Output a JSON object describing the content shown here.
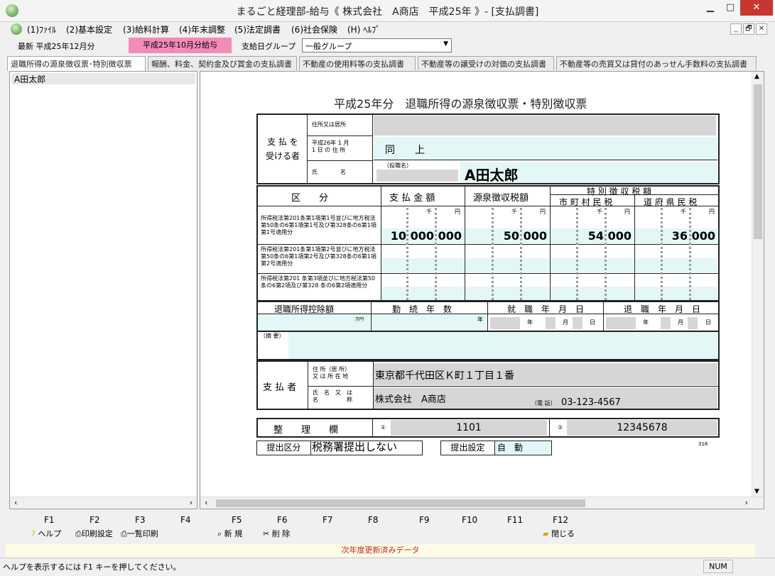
{
  "window": {
    "title": "まるごと経理部-給与《 株式会社　A商店　平成25年 》- [支払調書]",
    "minimize": "▁",
    "maximize": "□",
    "close": "✕"
  },
  "menu": {
    "items": [
      "(1)ﾌｧｲﾙ",
      "(2)基本設定",
      "(3)給料計算",
      "(4)年末調整",
      "(5)法定調書",
      "(6)社会保険",
      "(H) ﾍﾙﾌﾟ"
    ],
    "mdi_min": "_",
    "mdi_restore": "🗗",
    "mdi_close": "✕"
  },
  "toolbar": {
    "latest": "最新 平成25年12月分",
    "period_badge": "平成25年10月分給与",
    "group_label": "支給日グループ",
    "group_select": "一般グループ",
    "accent": "#f48ab8"
  },
  "tabs": [
    "退職所得の源泉徴収票･特別徴収票",
    "報酬、料金、契約金及び賞金の支払調書",
    "不動産の使用料等の支払調書",
    "不動産等の譲受けの対価の支払調書",
    "不動産等の売買又は貸付のあっせん手数料の支払調書"
  ],
  "employees": [
    "A田太郎"
  ],
  "form": {
    "title": "平成25年分　退職所得の源泉徴収票・特別徴収票",
    "recipient_label": "支 払 を\n受ける者",
    "address_label": "住所又は居所",
    "jan1_label": "平成26年 1 月\n 1 日 の 住 所",
    "jan1_value": "同　　上",
    "name_label": "氏　　　　名",
    "position_label": "（役職名）",
    "name_value": "A田太郎",
    "col_kubun": "区　　分",
    "col_amount": "支 払 金 額",
    "col_withholding": "源泉徴収税額",
    "col_special": "特 別 徴 収 税 額",
    "col_municipal": "市 町 村 民 税",
    "col_prefectural": "道 府 県 民 税",
    "unit_sen": "千",
    "unit_en": "円",
    "row1_label": "所得税法第201条第1項第1号並びに地方税法第50条の6第1項第1号及び第328条の6第1項第1号適用分",
    "row2_label": "所得税法第201条第1項第2号並びに地方税法第50条の6第1項第2号及び第328条の6第1項第2号適用分",
    "row3_label": "所得税法第201 条第3項並びに地方税法第50 条の6第2項及び第328 条の6第2項適用分",
    "row1_amount": "10 000 000",
    "row1_withholding": "50 000",
    "row1_municipal": "54 000",
    "row1_prefectural": "36 000",
    "deduction_label": "退職所得控除額",
    "years_label": "勤　続　年　数",
    "hire_label": "就　職　年　月　日",
    "retire_label": "退　職　年　月　日",
    "man_en": "万円",
    "nen": "年",
    "tsuki": "月",
    "hi": "日",
    "remarks_label": "（摘 要）",
    "payer_label": "支 払 者",
    "payer_address_label": "住 所（居 所）\n又 は 所 在 地",
    "payer_address": "東京都千代田区Ｋ町１丁目１番",
    "payer_name_label": "氏　名　又　は\n名　　　　　称",
    "payer_name": "株式会社　A商店",
    "tel_label": "（電 話）",
    "tel": "03-123-4567",
    "seiri_label": "整　　理　　欄",
    "seiri_1_mark": "①",
    "seiri_1": "1101",
    "seiri_2_mark": "②",
    "seiri_2": "12345678",
    "form_no": "316",
    "submit_label": "提出区分",
    "submit_value": "税務署提出しない",
    "submit_setting_label": "提出設定",
    "submit_setting_value": "自　動"
  },
  "fkeys": [
    "F1",
    "F2",
    "F3",
    "F4",
    "F5",
    "F6",
    "F7",
    "F8",
    "F9",
    "F10",
    "F11",
    "F12"
  ],
  "factions": {
    "help": "ヘルプ",
    "print_setting": "印刷設定",
    "list_print": "一覧印刷",
    "new": "新 規",
    "delete": "削 除",
    "close": "閉じる"
  },
  "notice": "次年度更新済みデータ",
  "status": {
    "hint": "ヘルプを表示するには F1 キーを押してください。",
    "num": "NUM"
  }
}
